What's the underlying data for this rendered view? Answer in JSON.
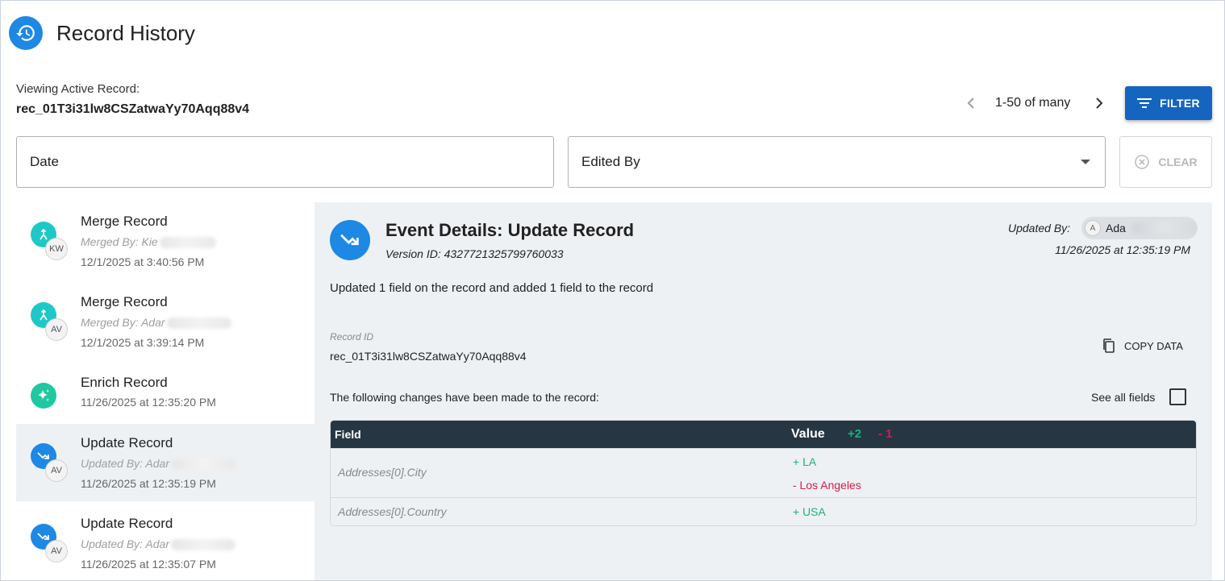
{
  "header": {
    "title": "Record History",
    "icon": "history-icon"
  },
  "viewing": {
    "label": "Viewing Active Record:",
    "record_id": "rec_01T3i31lw8CSZatwaYy70Aqq88v4"
  },
  "pager": {
    "text": "1-50 of many",
    "prev_icon": "chevron-left-icon",
    "next_icon": "chevron-right-icon"
  },
  "filter": {
    "label": "FILTER",
    "date_label": "Date",
    "edited_by_label": "Edited By",
    "clear_label": "CLEAR"
  },
  "history": [
    {
      "title": "Merge Record",
      "by": "Merged By: Kie",
      "initials": "KW",
      "date": "12/1/2025 at 3:40:56 PM",
      "icon": "merge-icon",
      "color": "#1fc8c8",
      "selected": false
    },
    {
      "title": "Merge Record",
      "by": "Merged By: Adar",
      "initials": "AV",
      "date": "12/1/2025 at 3:39:14 PM",
      "icon": "merge-icon",
      "color": "#1fc8c8",
      "selected": false
    },
    {
      "title": "Enrich Record",
      "by": "",
      "initials": "",
      "date": "11/26/2025 at 12:35:20 PM",
      "icon": "sparkle-icon",
      "color": "#1fc8a0",
      "selected": false
    },
    {
      "title": "Update Record",
      "by": "Updated By: Adar",
      "initials": "AV",
      "date": "11/26/2025 at 12:35:19 PM",
      "icon": "update-arrow-icon",
      "color": "#1e88e5",
      "selected": true
    },
    {
      "title": "Update Record",
      "by": "Updated By: Adar",
      "initials": "AV",
      "date": "11/26/2025 at 12:35:07 PM",
      "icon": "update-arrow-icon",
      "color": "#1e88e5",
      "selected": false
    }
  ],
  "details": {
    "title": "Event Details: Update Record",
    "version": "Version ID: 4327721325799760033",
    "updated_by_label": "Updated By:",
    "updated_by_initial": "A",
    "updated_by_name": "Ada",
    "date": "11/26/2025 at 12:35:19 PM",
    "summary": "Updated 1 field on the record and added 1 field to the record",
    "record_id_label": "Record ID",
    "record_id": "rec_01T3i31lw8CSZatwaYy70Aqq88v4",
    "copy_label": "COPY DATA",
    "changes_label": "The following changes have been made to the record:",
    "see_all_label": "See all fields",
    "see_all_checked": false
  },
  "changes_table": {
    "col_field": "Field",
    "col_value": "Value",
    "plus_count": "+2",
    "minus_count": "- 1",
    "rows": [
      {
        "field": "Addresses[0].City",
        "added": "+ LA",
        "removed": "- Los Angeles"
      },
      {
        "field": "Addresses[0].Country",
        "added": "+ USA",
        "removed": ""
      }
    ]
  },
  "colors": {
    "primary": "#1565c0",
    "accent": "#1e88e5",
    "teal": "#1fc8c8",
    "added": "#19b37a",
    "removed": "#d81b4a",
    "table_header": "#263743",
    "panel_bg": "#eef1f4"
  }
}
